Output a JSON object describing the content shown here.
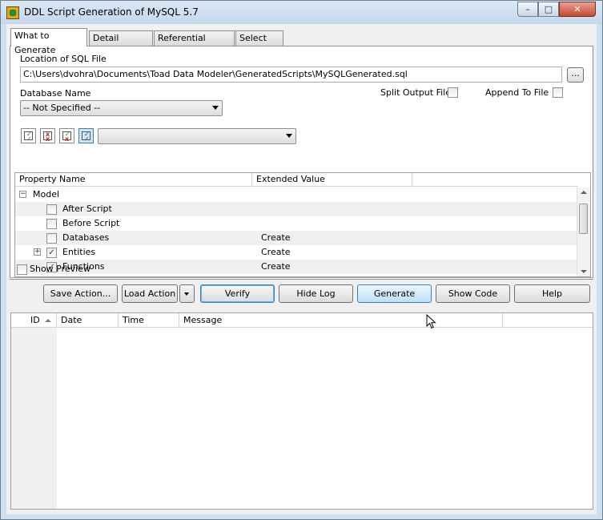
{
  "window": {
    "title": "DDL Script Generation of MySQL 5.7",
    "minimize": "–",
    "maximize": "□",
    "close": "✕"
  },
  "tabs": [
    {
      "label": "What to Generate",
      "active": true
    },
    {
      "label": "Detail Settings"
    },
    {
      "label": "Referential Integrity"
    },
    {
      "label": "Select List"
    }
  ],
  "location": {
    "label": "Location of SQL File",
    "value": "C:\\Users\\dvohra\\Documents\\Toad Data Modeler\\GeneratedScripts\\MySQLGenerated.sql",
    "browse": "..."
  },
  "database": {
    "label": "Database Name",
    "value": "-- Not Specified --"
  },
  "options": {
    "split_output": "Split Output File",
    "append_to_file": "Append To File"
  },
  "toolbar": {
    "icons": [
      "check-all-icon",
      "uncheck-all-icon",
      "invert-check-icon",
      "check-selected-icon"
    ],
    "filter_value": ""
  },
  "grid": {
    "headers": [
      "Property Name",
      "Extended Value"
    ],
    "rows": [
      {
        "name": "Model",
        "value": "",
        "level": 0,
        "checkbox": false,
        "expander": "−"
      },
      {
        "name": "After Script",
        "value": "",
        "level": 1,
        "checkbox": true,
        "checked": false
      },
      {
        "name": "Before Script",
        "value": "",
        "level": 1,
        "checkbox": true,
        "checked": false
      },
      {
        "name": "Databases",
        "value": "Create",
        "level": 1,
        "checkbox": true,
        "checked": false
      },
      {
        "name": "Entities",
        "value": "Create",
        "level": 1,
        "checkbox": true,
        "checked": true,
        "expander": "+"
      },
      {
        "name": "Functions",
        "value": "Create",
        "level": 1,
        "checkbox": true,
        "checked": true
      }
    ]
  },
  "show_preview": "Show Preview",
  "buttons": {
    "save_action": "Save Action...",
    "load_action": "Load Action",
    "verify": "Verify",
    "hide_log": "Hide Log",
    "generate": "Generate",
    "show_code": "Show Code",
    "help": "Help"
  },
  "log": {
    "headers": [
      "ID",
      "Date",
      "Time",
      "Message"
    ]
  },
  "colors": {
    "accent": "#3c7fb1",
    "hover": "#bfe2f7"
  }
}
